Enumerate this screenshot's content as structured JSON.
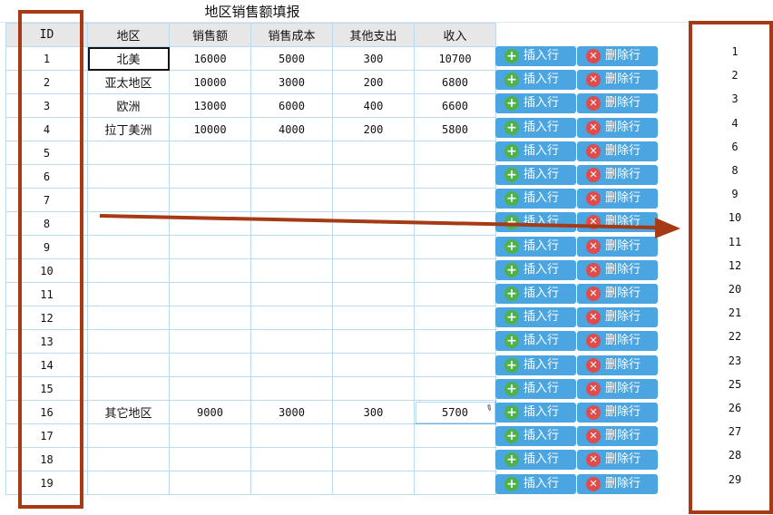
{
  "title": "地区销售额填报",
  "columns": [
    "ID",
    "地区",
    "销售额",
    "销售成本",
    "其他支出",
    "收入"
  ],
  "rows": [
    {
      "id": "1",
      "region": "北美",
      "sales": "16000",
      "cost": "5000",
      "other": "300",
      "income": "10700"
    },
    {
      "id": "2",
      "region": "亚太地区",
      "sales": "10000",
      "cost": "3000",
      "other": "200",
      "income": "6800"
    },
    {
      "id": "3",
      "region": "欧洲",
      "sales": "13000",
      "cost": "6000",
      "other": "400",
      "income": "6600"
    },
    {
      "id": "4",
      "region": "拉丁美洲",
      "sales": "10000",
      "cost": "4000",
      "other": "200",
      "income": "5800"
    },
    {
      "id": "5",
      "region": "",
      "sales": "",
      "cost": "",
      "other": "",
      "income": ""
    },
    {
      "id": "6",
      "region": "",
      "sales": "",
      "cost": "",
      "other": "",
      "income": ""
    },
    {
      "id": "7",
      "region": "",
      "sales": "",
      "cost": "",
      "other": "",
      "income": ""
    },
    {
      "id": "8",
      "region": "",
      "sales": "",
      "cost": "",
      "other": "",
      "income": ""
    },
    {
      "id": "9",
      "region": "",
      "sales": "",
      "cost": "",
      "other": "",
      "income": ""
    },
    {
      "id": "10",
      "region": "",
      "sales": "",
      "cost": "",
      "other": "",
      "income": ""
    },
    {
      "id": "11",
      "region": "",
      "sales": "",
      "cost": "",
      "other": "",
      "income": ""
    },
    {
      "id": "12",
      "region": "",
      "sales": "",
      "cost": "",
      "other": "",
      "income": ""
    },
    {
      "id": "13",
      "region": "",
      "sales": "",
      "cost": "",
      "other": "",
      "income": ""
    },
    {
      "id": "14",
      "region": "",
      "sales": "",
      "cost": "",
      "other": "",
      "income": ""
    },
    {
      "id": "15",
      "region": "",
      "sales": "",
      "cost": "",
      "other": "",
      "income": ""
    },
    {
      "id": "16",
      "region": "其它地区",
      "sales": "9000",
      "cost": "3000",
      "other": "300",
      "income": "5700"
    },
    {
      "id": "17",
      "region": "",
      "sales": "",
      "cost": "",
      "other": "",
      "income": ""
    },
    {
      "id": "18",
      "region": "",
      "sales": "",
      "cost": "",
      "other": "",
      "income": ""
    },
    {
      "id": "19",
      "region": "",
      "sales": "",
      "cost": "",
      "other": "",
      "income": ""
    }
  ],
  "buttons": {
    "insert": "插入行",
    "delete": "删除行"
  },
  "right_ids": [
    "1",
    "2",
    "3",
    "4",
    "6",
    "8",
    "9",
    "10",
    "11",
    "12",
    "20",
    "21",
    "22",
    "23",
    "25",
    "26",
    "27",
    "28",
    "29"
  ],
  "colors": {
    "frame": "#a53a14",
    "button": "#4aa5e0",
    "insert_icon": "#4cb34a",
    "delete_icon": "#e04c4c",
    "grid_border": "#b9daf0"
  },
  "icons": {
    "insert": "plus-circle-icon",
    "delete": "x-circle-icon",
    "edit": "pencil-icon"
  }
}
